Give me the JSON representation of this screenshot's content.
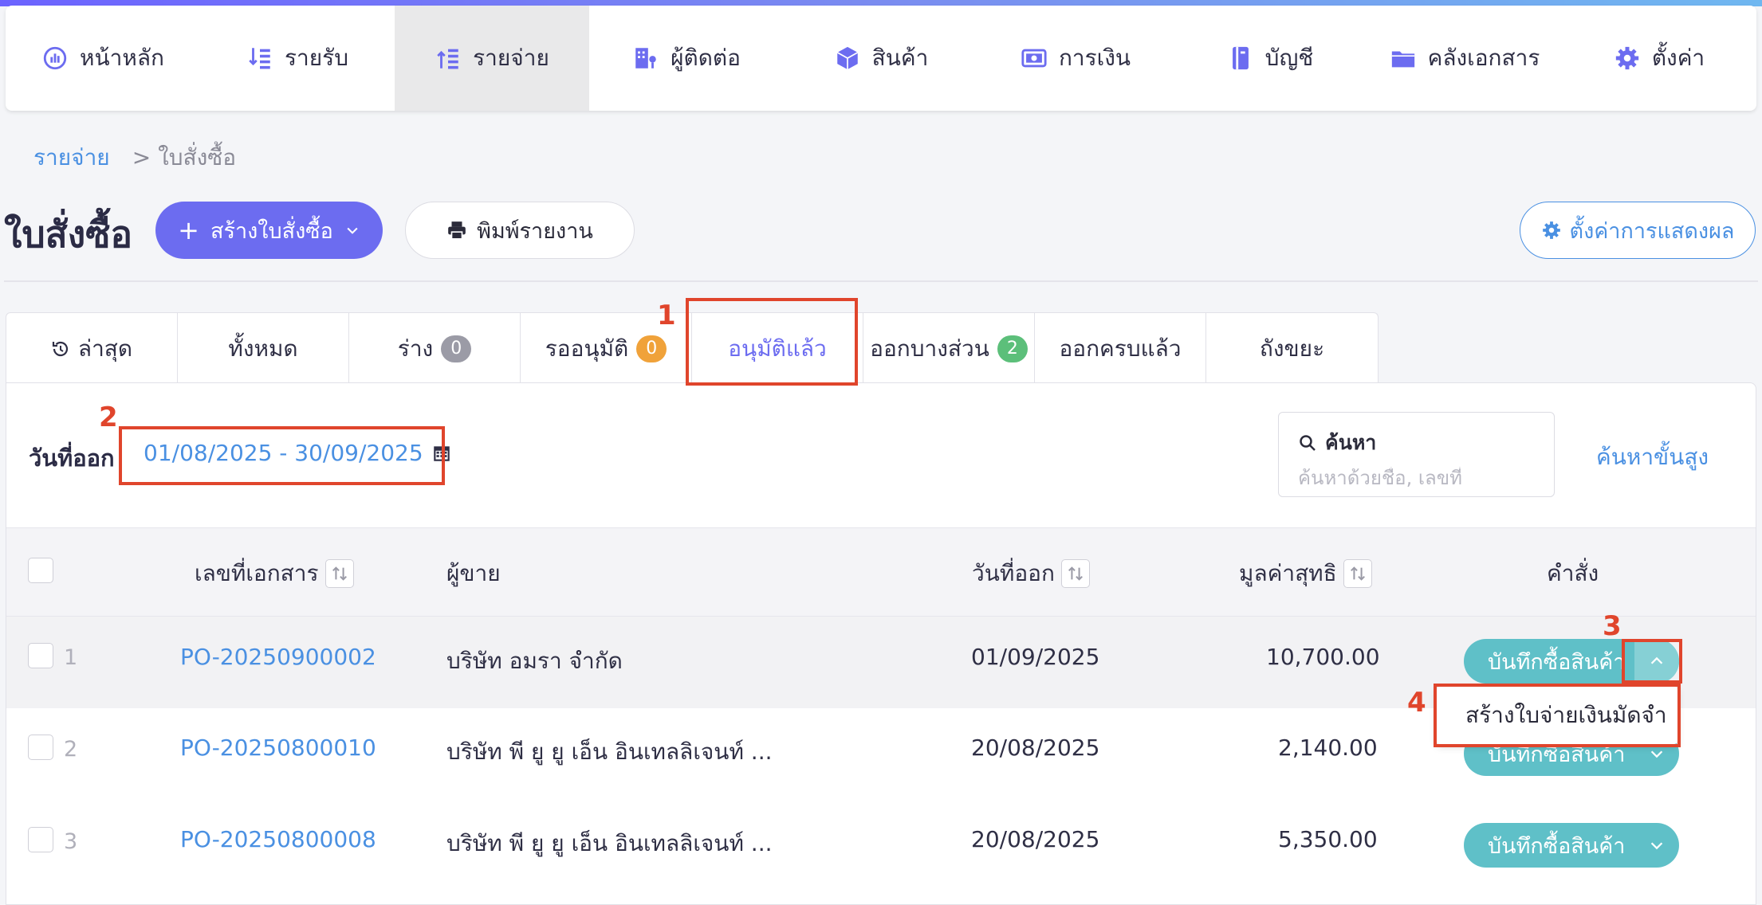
{
  "nav": {
    "items": [
      {
        "label": "หน้าหลัก",
        "icon": "dashboard-icon"
      },
      {
        "label": "รายรับ",
        "icon": "income-icon"
      },
      {
        "label": "รายจ่าย",
        "icon": "expense-icon",
        "active": true
      },
      {
        "label": "ผู้ติดต่อ",
        "icon": "contacts-icon"
      },
      {
        "label": "สินค้า",
        "icon": "box-icon"
      },
      {
        "label": "การเงิน",
        "icon": "money-icon"
      },
      {
        "label": "บัญชี",
        "icon": "ledger-icon"
      },
      {
        "label": "คลังเอกสาร",
        "icon": "folder-icon"
      },
      {
        "label": "ตั้งค่า",
        "icon": "gear-icon"
      }
    ]
  },
  "breadcrumb": {
    "parent": "รายจ่าย",
    "separator": ">",
    "current": "ใบสั่งซื้อ"
  },
  "header": {
    "title": "ใบสั่งซื้อ",
    "create_label": "สร้างใบสั่งซื้อ",
    "print_label": "พิมพ์รายงาน",
    "display_settings_label": "ตั้งค่าการแสดงผล"
  },
  "tabs": [
    {
      "label": "ล่าสุด"
    },
    {
      "label": "ทั้งหมด"
    },
    {
      "label": "ร่าง",
      "badge": "0"
    },
    {
      "label": "รออนุมัติ",
      "badge": "0"
    },
    {
      "label": "อนุมัติแล้ว",
      "active": true
    },
    {
      "label": "ออกบางส่วน",
      "badge": "2"
    },
    {
      "label": "ออกครบแล้ว"
    },
    {
      "label": "ถังขยะ"
    }
  ],
  "filter": {
    "label": "วันที่ออก",
    "date_range": "01/08/2025 - 30/09/2025"
  },
  "search": {
    "title": "ค้นหา",
    "placeholder": "ค้นหาด้วยชื่อ, เลขที่",
    "advanced_label": "ค้นหาขั้นสูง"
  },
  "table": {
    "columns": {
      "doc_no": "เลขที่เอกสาร",
      "vendor": "ผู้ขาย",
      "issue_date": "วันที่ออก",
      "net_value": "มูลค่าสุทธิ",
      "actions": "คำสั่ง"
    },
    "rows": [
      {
        "num": "1",
        "doc_no": "PO-20250900002",
        "vendor": "บริษัท อมรา จำกัด",
        "issue_date": "01/09/2025",
        "net_value": "10,700.00",
        "action": "บันทึกซื้อสินค้า"
      },
      {
        "num": "2",
        "doc_no": "PO-20250800010",
        "vendor": "บริษัท พี ยู ยู เอ็น อินเทลลิเจนท์ ...",
        "issue_date": "20/08/2025",
        "net_value": "2,140.00",
        "action": "บันทึกซื้อสินค้า"
      },
      {
        "num": "3",
        "doc_no": "PO-20250800008",
        "vendor": "บริษัท พี ยู ยู เอ็น อินเทลลิเจนท์ ...",
        "issue_date": "20/08/2025",
        "net_value": "5,350.00",
        "action": "บันทึกซื้อสินค้า"
      }
    ]
  },
  "dropdown": {
    "item": "สร้างใบจ่ายเงินมัดจำ"
  },
  "annotations": [
    "1",
    "2",
    "3",
    "4"
  ],
  "colors": {
    "primary": "#6c6cf0",
    "link": "#4a90e2",
    "action": "#5fc0c8",
    "annotation": "#e0452c"
  }
}
